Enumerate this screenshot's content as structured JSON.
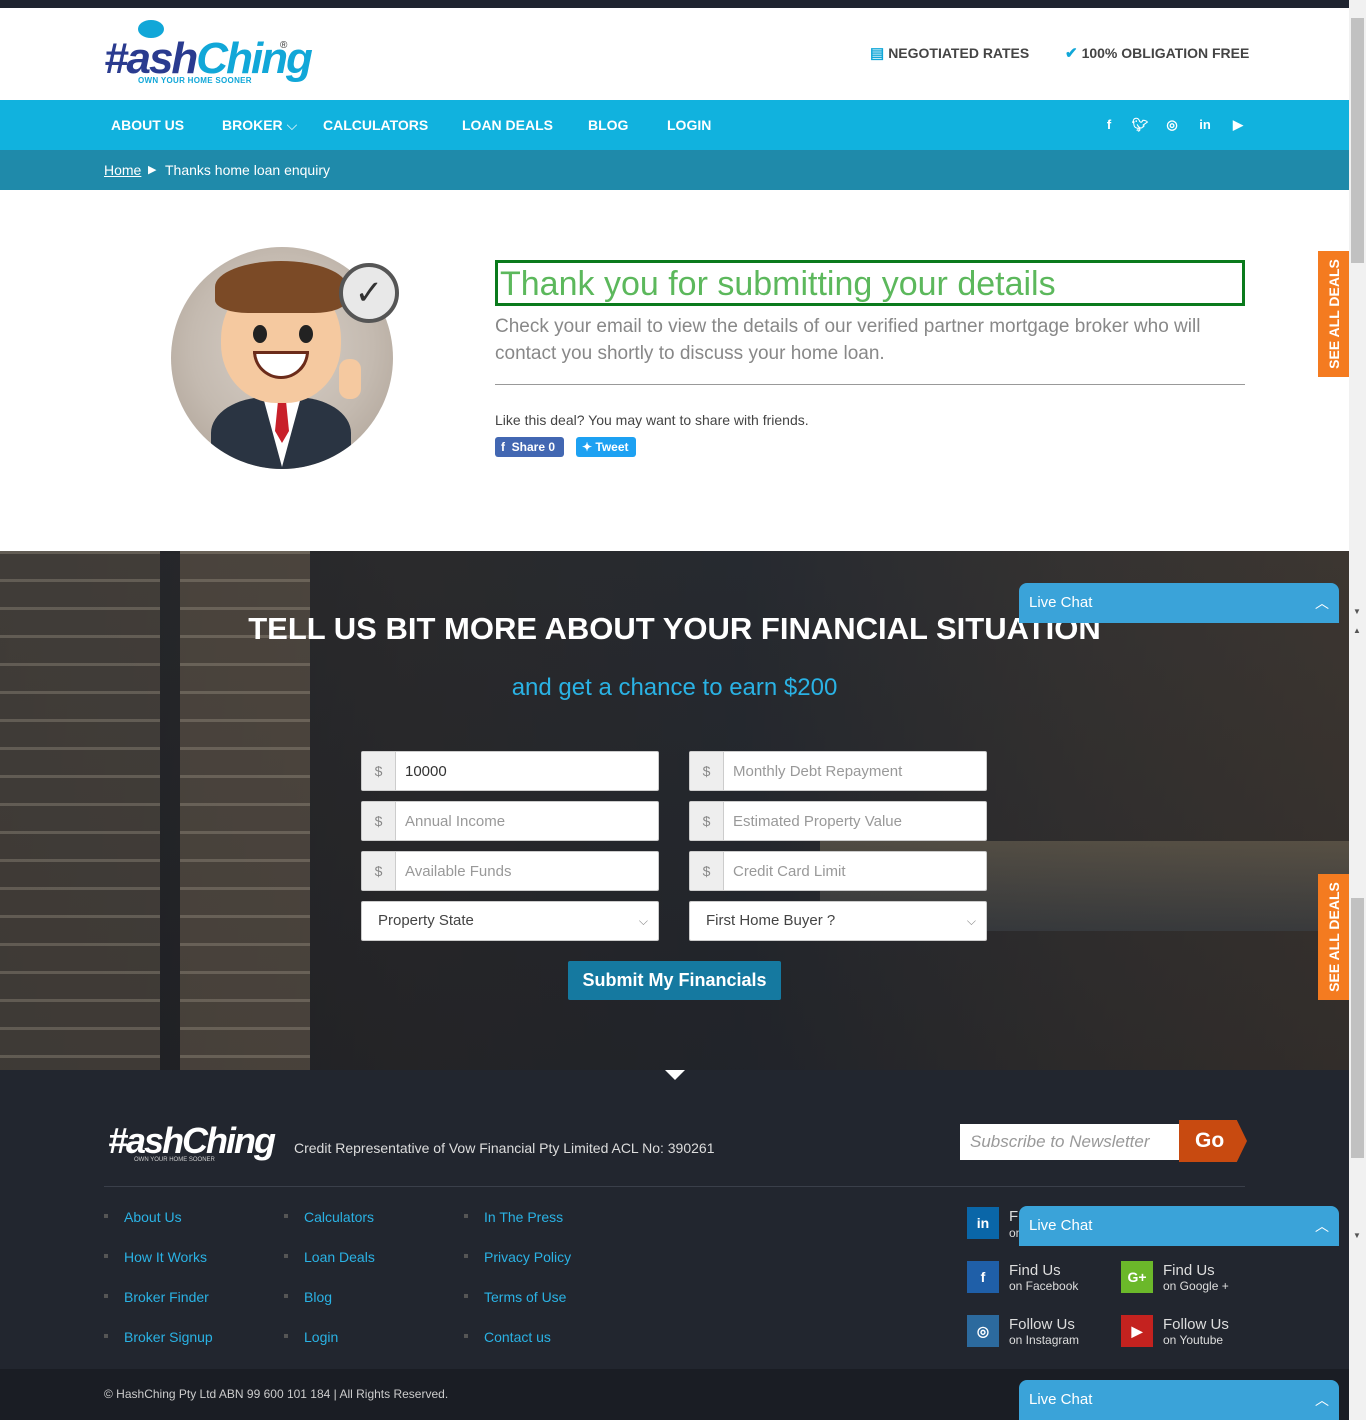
{
  "header": {
    "logo_text_a": "#ash",
    "logo_text_b": "Ching",
    "logo_tag": "OWN YOUR HOME SOONER",
    "logo_reg": "®",
    "feature_1": "NEGOTIATED RATES",
    "feature_2": "100% OBLIGATION FREE"
  },
  "nav": {
    "items": [
      "ABOUT US",
      "BROKER",
      "CALCULATORS",
      "LOAN DEALS",
      "BLOG",
      "LOGIN"
    ],
    "social": [
      "f",
      "t",
      "ig",
      "in",
      "yt"
    ]
  },
  "breadcrumb": {
    "home": "Home",
    "current": "Thanks home loan enquiry"
  },
  "hero": {
    "title": "Thank you for submitting your details",
    "subtitle": "Check your email to view the details of our verified partner mortgage broker who will contact you shortly to discuss your home loan.",
    "share_text": "Like this deal? You may want to share with friends.",
    "fb_share": "Share 0",
    "tweet": "Tweet"
  },
  "side_tab": {
    "label": "SEE ALL DEALS"
  },
  "financials": {
    "title": "TELL US BIT MORE ABOUT YOUR FINANCIAL SITUATION",
    "subtitle": "and get a chance to earn $200",
    "currency": "$",
    "fields": {
      "loan_amount": {
        "value": "10000",
        "placeholder": ""
      },
      "monthly_debt": {
        "value": "",
        "placeholder": "Monthly Debt Repayment"
      },
      "annual_income": {
        "value": "",
        "placeholder": "Annual Income"
      },
      "property_value": {
        "value": "",
        "placeholder": "Estimated Property Value"
      },
      "available_funds": {
        "value": "",
        "placeholder": "Available Funds"
      },
      "credit_limit": {
        "value": "",
        "placeholder": "Credit Card Limit"
      }
    },
    "property_state": "Property State",
    "first_home_buyer": "First Home Buyer ?",
    "submit": "Submit My Financials"
  },
  "footer": {
    "logo_text": "#ashChing",
    "logo_tag": "OWN YOUR HOME SOONER",
    "credit": "Credit Representative of Vow Financial Pty Limited ACL No: 390261",
    "newsletter_placeholder": "Subscribe to Newsletter",
    "go": "Go",
    "links_col1": [
      "About Us",
      "How It Works",
      "Broker Finder",
      "Broker Signup"
    ],
    "links_col2": [
      "Calculators",
      "Loan Deals",
      "Blog",
      "Login"
    ],
    "links_col3": [
      "In The Press",
      "Privacy Policy",
      "Terms of Use",
      "Contact us"
    ],
    "social": {
      "linkedin": {
        "t1": "F",
        "t2": "on"
      },
      "facebook": {
        "t1": "Find Us",
        "t2": "on Facebook"
      },
      "google": {
        "t1": "Find Us",
        "t2": "on Google +"
      },
      "instagram": {
        "t1": "Follow Us",
        "t2": "on Instagram"
      },
      "youtube": {
        "t1": "Follow Us",
        "t2": "on Youtube"
      }
    },
    "copyright": "© HashChing Pty Ltd   ABN 99 600 101 184   |   All Rights Reserved."
  },
  "livechat": {
    "label": "Live Chat"
  },
  "colors": {
    "nav": "#11b2de",
    "breadcrumb": "#1f8aaa",
    "accent_orange": "#f47b20",
    "title_green": "#5cb85c"
  }
}
